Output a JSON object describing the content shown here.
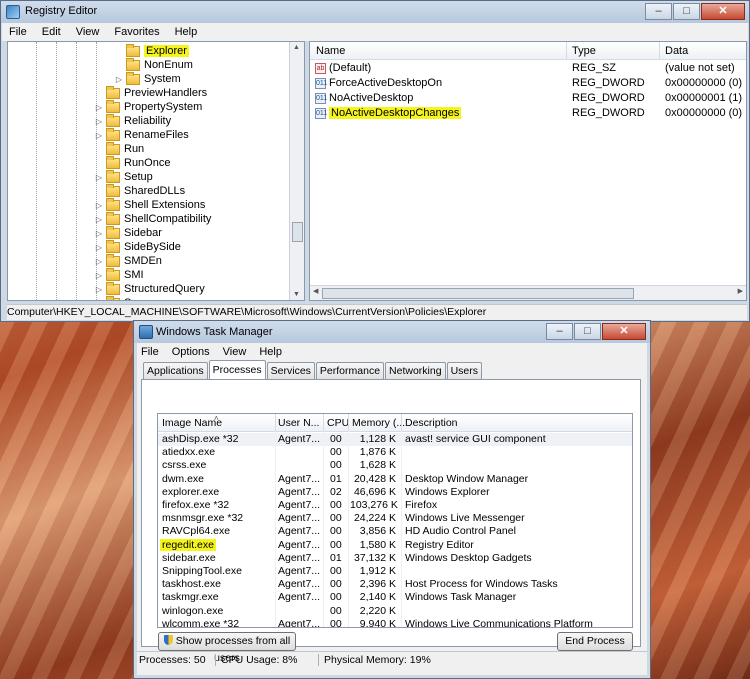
{
  "registry": {
    "title": "Registry Editor",
    "menu": [
      "File",
      "Edit",
      "View",
      "Favorites",
      "Help"
    ],
    "tree_items": [
      {
        "label": "Explorer",
        "indent": 3,
        "expander": "",
        "highlight": true
      },
      {
        "label": "NonEnum",
        "indent": 3,
        "expander": "",
        "highlight": false
      },
      {
        "label": "System",
        "indent": 3,
        "expander": "▷",
        "highlight": false
      },
      {
        "label": "PreviewHandlers",
        "indent": 2,
        "expander": "",
        "highlight": false
      },
      {
        "label": "PropertySystem",
        "indent": 2,
        "expander": "▷",
        "highlight": false
      },
      {
        "label": "Reliability",
        "indent": 2,
        "expander": "▷",
        "highlight": false
      },
      {
        "label": "RenameFiles",
        "indent": 2,
        "expander": "▷",
        "highlight": false
      },
      {
        "label": "Run",
        "indent": 2,
        "expander": "",
        "highlight": false
      },
      {
        "label": "RunOnce",
        "indent": 2,
        "expander": "",
        "highlight": false
      },
      {
        "label": "Setup",
        "indent": 2,
        "expander": "▷",
        "highlight": false
      },
      {
        "label": "SharedDLLs",
        "indent": 2,
        "expander": "",
        "highlight": false
      },
      {
        "label": "Shell Extensions",
        "indent": 2,
        "expander": "▷",
        "highlight": false
      },
      {
        "label": "ShellCompatibility",
        "indent": 2,
        "expander": "▷",
        "highlight": false
      },
      {
        "label": "Sidebar",
        "indent": 2,
        "expander": "▷",
        "highlight": false
      },
      {
        "label": "SideBySide",
        "indent": 2,
        "expander": "▷",
        "highlight": false
      },
      {
        "label": "SMDEn",
        "indent": 2,
        "expander": "▷",
        "highlight": false
      },
      {
        "label": "SMI",
        "indent": 2,
        "expander": "▷",
        "highlight": false
      },
      {
        "label": "StructuredQuery",
        "indent": 2,
        "expander": "▷",
        "highlight": false
      },
      {
        "label": "Syncmgr",
        "indent": 2,
        "expander": "▷",
        "highlight": false
      }
    ],
    "columns": {
      "name": "Name",
      "type": "Type",
      "data": "Data"
    },
    "values": [
      {
        "icon": "ab",
        "name": "(Default)",
        "type": "REG_SZ",
        "data": "(value not set)",
        "highlight": false
      },
      {
        "icon": "011",
        "name": "ForceActiveDesktopOn",
        "type": "REG_DWORD",
        "data": "0x00000000 (0)",
        "highlight": false
      },
      {
        "icon": "011",
        "name": "NoActiveDesktop",
        "type": "REG_DWORD",
        "data": "0x00000001 (1)",
        "highlight": false
      },
      {
        "icon": "011",
        "name": "NoActiveDesktopChanges",
        "type": "REG_DWORD",
        "data": "0x00000000 (0)",
        "highlight": true
      }
    ],
    "status_path": "Computer\\HKEY_LOCAL_MACHINE\\SOFTWARE\\Microsoft\\Windows\\CurrentVersion\\Policies\\Explorer"
  },
  "taskmgr": {
    "title": "Windows Task Manager",
    "menu": [
      "File",
      "Options",
      "View",
      "Help"
    ],
    "tabs": [
      "Applications",
      "Processes",
      "Services",
      "Performance",
      "Networking",
      "Users"
    ],
    "active_tab": "Processes",
    "columns": {
      "image": "Image Name",
      "user": "User N...",
      "cpu": "CPU",
      "memory": "Memory (...",
      "description": "Description"
    },
    "processes": [
      {
        "image": "ashDisp.exe *32",
        "user": "Agent7...",
        "cpu": "00",
        "memory": "1,128 K",
        "description": "avast! service GUI component",
        "highlight": false
      },
      {
        "image": "atiedxx.exe",
        "user": "",
        "cpu": "00",
        "memory": "1,876 K",
        "description": "",
        "highlight": false
      },
      {
        "image": "csrss.exe",
        "user": "",
        "cpu": "00",
        "memory": "1,628 K",
        "description": "",
        "highlight": false
      },
      {
        "image": "dwm.exe",
        "user": "Agent7...",
        "cpu": "01",
        "memory": "20,428 K",
        "description": "Desktop Window Manager",
        "highlight": false
      },
      {
        "image": "explorer.exe",
        "user": "Agent7...",
        "cpu": "02",
        "memory": "46,696 K",
        "description": "Windows Explorer",
        "highlight": false
      },
      {
        "image": "firefox.exe *32",
        "user": "Agent7...",
        "cpu": "00",
        "memory": "103,276 K",
        "description": "Firefox",
        "highlight": false
      },
      {
        "image": "msnmsgr.exe *32",
        "user": "Agent7...",
        "cpu": "00",
        "memory": "24,224 K",
        "description": "Windows Live Messenger",
        "highlight": false
      },
      {
        "image": "RAVCpl64.exe",
        "user": "Agent7...",
        "cpu": "00",
        "memory": "3,856 K",
        "description": "HD Audio Control Panel",
        "highlight": false
      },
      {
        "image": "regedit.exe",
        "user": "Agent7...",
        "cpu": "00",
        "memory": "1,580 K",
        "description": "Registry Editor",
        "highlight": true
      },
      {
        "image": "sidebar.exe",
        "user": "Agent7...",
        "cpu": "01",
        "memory": "37,132 K",
        "description": "Windows Desktop Gadgets",
        "highlight": false
      },
      {
        "image": "SnippingTool.exe",
        "user": "Agent7...",
        "cpu": "00",
        "memory": "1,912 K",
        "description": "",
        "highlight": false
      },
      {
        "image": "taskhost.exe",
        "user": "Agent7...",
        "cpu": "00",
        "memory": "2,396 K",
        "description": "Host Process for Windows Tasks",
        "highlight": false
      },
      {
        "image": "taskmgr.exe",
        "user": "Agent7...",
        "cpu": "00",
        "memory": "2,140 K",
        "description": "Windows Task Manager",
        "highlight": false
      },
      {
        "image": "winlogon.exe",
        "user": "",
        "cpu": "00",
        "memory": "2,220 K",
        "description": "",
        "highlight": false
      },
      {
        "image": "wlcomm.exe *32",
        "user": "Agent7...",
        "cpu": "00",
        "memory": "9,940 K",
        "description": "Windows Live Communications Platform",
        "highlight": false
      }
    ],
    "show_all_label": "Show processes from all users",
    "end_process_label": "End Process",
    "status": {
      "processes": "Processes: 50",
      "cpu": "CPU Usage: 8%",
      "memory": "Physical Memory: 19%"
    }
  },
  "colors": {
    "highlight": "#f5f51a",
    "titlebar": "#b7c8dd",
    "close_button": "#c64a32"
  }
}
